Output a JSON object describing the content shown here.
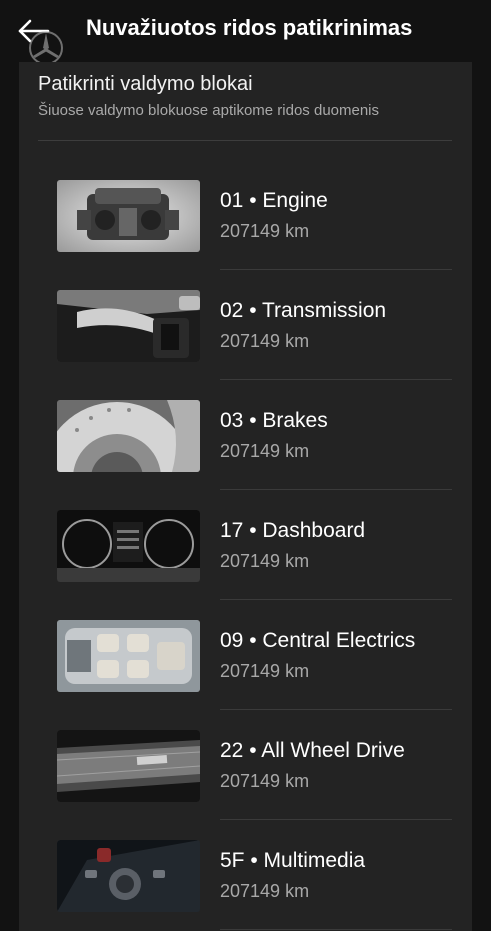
{
  "header": {
    "title": "Nuvažiuotos ridos patikrinimas",
    "back_icon": "arrow-left-icon"
  },
  "section": {
    "title": "Patikrinti valdymo blokai",
    "subtitle": "Šiuose valdymo blokuose aptikome ridos duomenis"
  },
  "modules": [
    {
      "label": "01 • Engine",
      "mileage": "207149 km",
      "thumbnail": "engine-photo"
    },
    {
      "label": "02 • Transmission",
      "mileage": "207149 km",
      "thumbnail": "gear-shifter-photo"
    },
    {
      "label": "03 • Brakes",
      "mileage": "207149 km",
      "thumbnail": "brake-disc-photo"
    },
    {
      "label": "17 • Dashboard",
      "mileage": "207149 km",
      "thumbnail": "instrument-cluster-photo"
    },
    {
      "label": "09 • Central Electrics",
      "mileage": "207149 km",
      "thumbnail": "car-chassis-photo"
    },
    {
      "label": "22 • All Wheel Drive",
      "mileage": "207149 km",
      "thumbnail": "quattro-sill-photo"
    },
    {
      "label": "5F • Multimedia",
      "mileage": "207149 km",
      "thumbnail": "mmi-controller-photo"
    }
  ],
  "colors": {
    "background": "#121212",
    "card": "#232323",
    "text_primary": "#ffffff",
    "text_secondary": "#a8a8a8"
  }
}
